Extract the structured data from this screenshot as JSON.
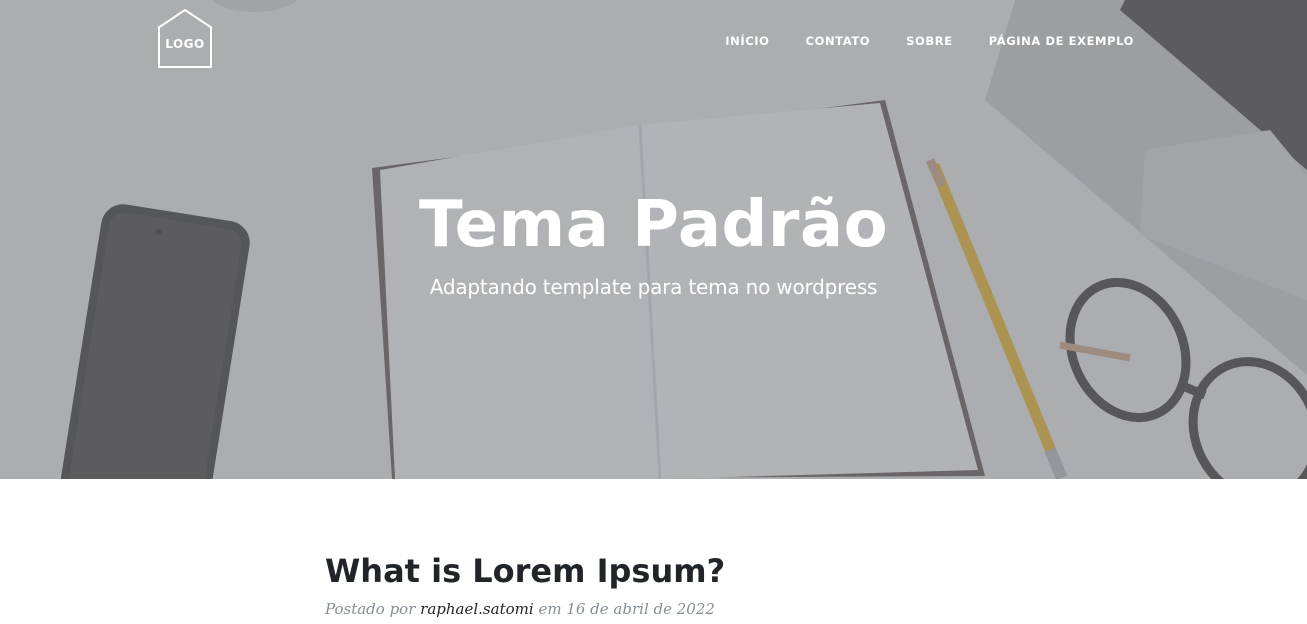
{
  "header": {
    "logo_text": "LOGO",
    "nav": [
      {
        "label": "INÍCIO"
      },
      {
        "label": "CONTATO"
      },
      {
        "label": "SOBRE"
      },
      {
        "label": "PÁGINA DE EXEMPLO"
      }
    ]
  },
  "hero": {
    "title": "Tema Padrão",
    "subtitle": "Adaptando template para tema no wordpress",
    "background_scene": [
      "smartphone",
      "notebook",
      "pencil",
      "glasses",
      "laptop"
    ]
  },
  "post": {
    "title": "What is Lorem Ipsum?",
    "meta_prefix": "Postado por",
    "author": "raphael.satomi",
    "date_prefix": "em",
    "date": "16 de abril de 2022"
  },
  "colors": {
    "hero_overlay": "#787a80",
    "text_dark": "#212529",
    "meta_gray": "#868e96"
  }
}
